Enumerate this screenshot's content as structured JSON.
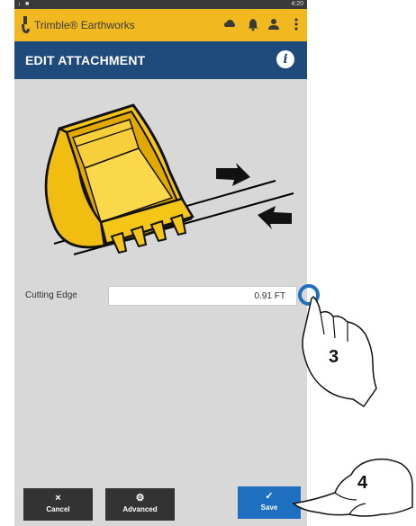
{
  "status_bar": {
    "time": "4:20"
  },
  "app_bar": {
    "title": "Trimble® Earthworks",
    "icons": [
      "trimble-logo-icon",
      "cloud-icon",
      "notification-icon",
      "operator-icon",
      "more-vertical-icon"
    ]
  },
  "header": {
    "title": "EDIT ATTACHMENT",
    "info_icon": "info-icon"
  },
  "illustration": {
    "name": "bucket-cutting-edge-illustration"
  },
  "cutting_edge": {
    "label": "Cutting Edge",
    "value": "0.91 FT"
  },
  "buttons": {
    "cancel": {
      "glyph": "×",
      "label": "Cancel"
    },
    "advanced": {
      "glyph": "⚙",
      "label": "Advanced"
    },
    "save": {
      "glyph": "✓",
      "label": "Save"
    }
  },
  "callouts": {
    "step_3": "3",
    "step_4": "4"
  },
  "colors": {
    "app_bar": "#f2b81f",
    "header": "#1e4a7c",
    "save": "#1e6fc0",
    "bucket": "#f5c518"
  }
}
